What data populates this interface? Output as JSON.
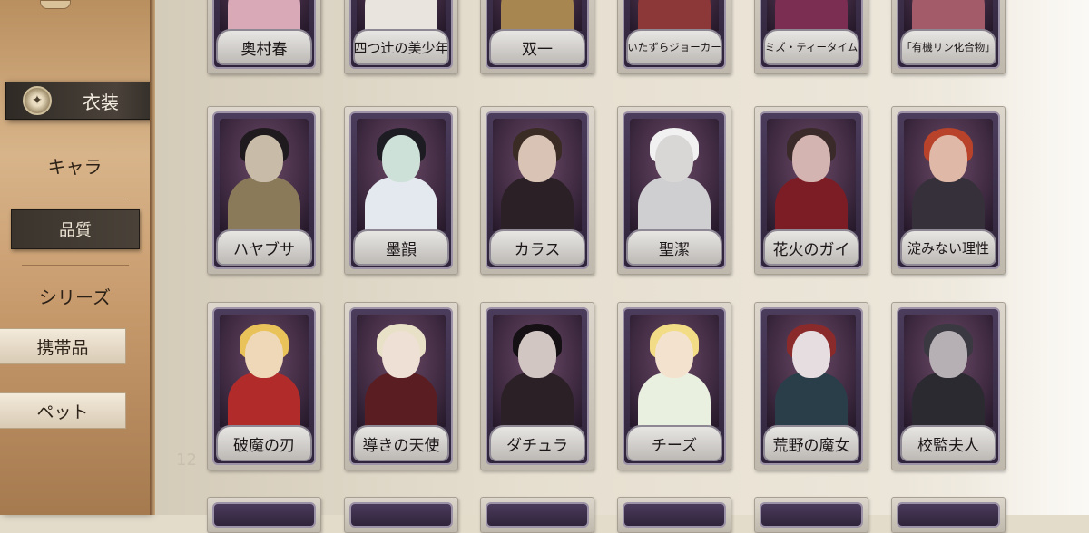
{
  "sidebar": {
    "costume_tab": "衣装",
    "items": [
      "キャラ",
      "品質",
      "シリーズ",
      "携帯品",
      "ペット"
    ]
  },
  "grid": {
    "row_number": "12",
    "rows": [
      [
        "奥村春",
        "四つ辻の美少年",
        "双一",
        "いたずらジョーカー",
        "ミズ・ティータイム",
        "「有機リン化合物」"
      ],
      [
        "ハヤブサ",
        "墨韻",
        "カラス",
        "聖潔",
        "花火のガイ",
        "淀みない理性"
      ],
      [
        "破魔の刃",
        "導きの天使",
        "ダチュラ",
        "チーズ",
        "荒野の魔女",
        "校監夫人"
      ]
    ]
  },
  "colors": {
    "card_frame": "#4b3c5c",
    "sidebar_wood": "#c79a6c",
    "active_tab": "#3a342d"
  }
}
